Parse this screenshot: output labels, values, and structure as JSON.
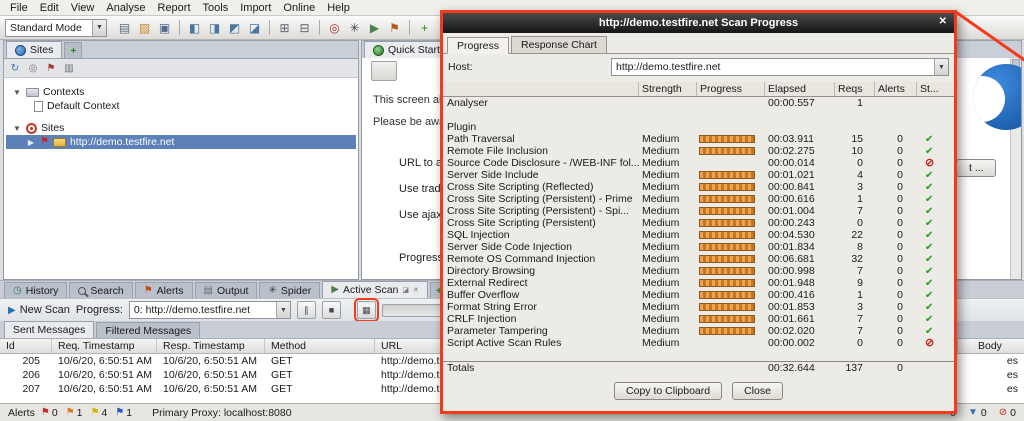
{
  "annotation_color": "#f43a1a",
  "menu": {
    "items": [
      "File",
      "Edit",
      "View",
      "Analyse",
      "Report",
      "Tools",
      "Import",
      "Online",
      "Help"
    ]
  },
  "toolbar": {
    "mode": "Standard Mode",
    "icons": [
      {
        "name": "new-session-icon",
        "glyph": "▤",
        "color": "#5b6c7c"
      },
      {
        "name": "open-session-icon",
        "glyph": "▨",
        "color": "#c08f2c"
      },
      {
        "name": "persist-session-icon",
        "glyph": "▣",
        "color": "#50688a"
      },
      {
        "name": "separator"
      },
      {
        "name": "maximize-pane-icon",
        "glyph": "◧",
        "color": "#49759f"
      },
      {
        "name": "layout-left-icon",
        "glyph": "◨",
        "color": "#49759f"
      },
      {
        "name": "layout-top-icon",
        "glyph": "◩",
        "color": "#49759f"
      },
      {
        "name": "layout-full-icon",
        "glyph": "◪",
        "color": "#49759f"
      },
      {
        "name": "separator"
      },
      {
        "name": "expand-tree-icon",
        "glyph": "⊞",
        "color": "#5a5f66"
      },
      {
        "name": "collapse-tree-icon",
        "glyph": "⊟",
        "color": "#5a5f66"
      },
      {
        "name": "separator"
      },
      {
        "name": "target-scope-icon",
        "glyph": "◎",
        "color": "#b03030"
      },
      {
        "name": "spider-icon",
        "glyph": "✳",
        "color": "#3d4247"
      },
      {
        "name": "active-scan-icon",
        "glyph": "▶",
        "color": "#4c7f4c"
      },
      {
        "name": "alerts-flag-icon",
        "glyph": "⚑",
        "color": "#b35a1f"
      },
      {
        "name": "separator"
      },
      {
        "name": "add-icon",
        "glyph": "+",
        "color": "#2e8b2e"
      },
      {
        "name": "stop-all-icon",
        "glyph": "✕",
        "color": "#c03030"
      },
      {
        "name": "refresh-icon",
        "glyph": "↻",
        "color": "#3a6fae"
      }
    ]
  },
  "left_panel": {
    "tab": "Sites",
    "add_tab": "+",
    "toolbar_icons": [
      {
        "name": "refresh-sites-icon",
        "glyph": "↻",
        "color": "#3a6fae"
      },
      {
        "name": "scope-filter-icon",
        "glyph": "◎",
        "color": "#777777"
      },
      {
        "name": "flag-filter-icon",
        "glyph": "⚑",
        "color": "#a33a2a"
      },
      {
        "name": "list-view-icon",
        "glyph": "▥",
        "color": "#666e78"
      }
    ],
    "tree": {
      "contexts": "Contexts",
      "default_context": "Default Context",
      "sites": "Sites",
      "site": "http://demo.testfire.net"
    }
  },
  "quick_start": {
    "tab": "Quick Start",
    "lines": [
      "This screen allo",
      "Please be awa"
    ],
    "field_labels": [
      "URL to at",
      "Use tradi",
      "Use ajax",
      "Progress"
    ],
    "button_fragment": "t ..."
  },
  "bottom_tabs": {
    "tabs": [
      "History",
      "Search",
      "Alerts",
      "Output",
      "Spider",
      "Active Scan"
    ],
    "add_tab": "+"
  },
  "scan_toolbar": {
    "new_scan": "New Scan",
    "progress_label": "Progress:",
    "progress_value": "0: http://demo.testfire.net"
  },
  "messages": {
    "tabs": [
      "Sent Messages",
      "Filtered Messages"
    ],
    "columns": [
      "Id",
      "Req. Timestamp",
      "Resp. Timestamp",
      "Method",
      "URL",
      "Body"
    ],
    "rows": [
      {
        "id": "205",
        "req": "10/6/20, 6:50:51 AM",
        "resp": "10/6/20, 6:50:51 AM",
        "method": "GET",
        "url": "http://demo.t",
        "body": "es"
      },
      {
        "id": "206",
        "req": "10/6/20, 6:50:51 AM",
        "resp": "10/6/20, 6:50:51 AM",
        "method": "GET",
        "url": "http://demo.t",
        "body": "es"
      },
      {
        "id": "207",
        "req": "10/6/20, 6:50:51 AM",
        "resp": "10/6/20, 6:50:51 AM",
        "method": "GET",
        "url": "http://demo.t",
        "body": "es"
      }
    ]
  },
  "status_bar": {
    "alerts_label": "Alerts",
    "flags": [
      {
        "name": "red-flag-count",
        "color": "#cc2a2a",
        "count": "0"
      },
      {
        "name": "orange-flag-count",
        "color": "#e07b1f",
        "count": "1"
      },
      {
        "name": "yellow-flag-count",
        "color": "#d0b40a",
        "count": "4"
      },
      {
        "name": "blue-flag-count",
        "color": "#2457c5",
        "count": "1"
      }
    ],
    "proxy": "Primary Proxy: localhost:8080",
    "right_counters": [
      {
        "name": "scan-progress-count",
        "glyph": "◐",
        "color": "#667",
        "count": "0"
      },
      {
        "name": "download-count",
        "glyph": "▼",
        "color": "#3a6fae",
        "count": "0"
      },
      {
        "name": "blocked-count",
        "glyph": "⊘",
        "color": "#cc2418",
        "count": "0"
      }
    ]
  },
  "dialog": {
    "title": "http://demo.testfire.net Scan Progress",
    "tabs": [
      "Progress",
      "Response Chart"
    ],
    "host_label": "Host:",
    "host_value": "http://demo.testfire.net",
    "columns": [
      "",
      "Strength",
      "Progress",
      "Elapsed",
      "Reqs",
      "Alerts",
      "St..."
    ],
    "rows": [
      {
        "name": "Analyser",
        "strength": "",
        "bar": false,
        "elapsed": "00:00.557",
        "reqs": "1",
        "alerts": "",
        "status": ""
      },
      {
        "name": "",
        "strength": "",
        "bar": false,
        "elapsed": "",
        "reqs": "",
        "alerts": "",
        "status": ""
      },
      {
        "name": "Plugin",
        "strength": "",
        "bar": false,
        "elapsed": "",
        "reqs": "",
        "alerts": "",
        "status": ""
      },
      {
        "name": "Path Traversal",
        "strength": "Medium",
        "bar": true,
        "elapsed": "00:03.911",
        "reqs": "15",
        "alerts": "0",
        "status": "ok"
      },
      {
        "name": "Remote File Inclusion",
        "strength": "Medium",
        "bar": true,
        "elapsed": "00:02.275",
        "reqs": "10",
        "alerts": "0",
        "status": "ok"
      },
      {
        "name": "Source Code Disclosure - /WEB-INF fol...",
        "strength": "Medium",
        "bar": false,
        "elapsed": "00:00.014",
        "reqs": "0",
        "alerts": "0",
        "status": "skip"
      },
      {
        "name": "Server Side Include",
        "strength": "Medium",
        "bar": true,
        "elapsed": "00:01.021",
        "reqs": "4",
        "alerts": "0",
        "status": "ok"
      },
      {
        "name": "Cross Site Scripting (Reflected)",
        "strength": "Medium",
        "bar": true,
        "elapsed": "00:00.841",
        "reqs": "3",
        "alerts": "0",
        "status": "ok"
      },
      {
        "name": "Cross Site Scripting (Persistent) - Prime",
        "strength": "Medium",
        "bar": true,
        "elapsed": "00:00.616",
        "reqs": "1",
        "alerts": "0",
        "status": "ok"
      },
      {
        "name": "Cross Site Scripting (Persistent) - Spi...",
        "strength": "Medium",
        "bar": true,
        "elapsed": "00:01.004",
        "reqs": "7",
        "alerts": "0",
        "status": "ok"
      },
      {
        "name": "Cross Site Scripting (Persistent)",
        "strength": "Medium",
        "bar": true,
        "elapsed": "00:00.243",
        "reqs": "0",
        "alerts": "0",
        "status": "ok"
      },
      {
        "name": "SQL Injection",
        "strength": "Medium",
        "bar": true,
        "elapsed": "00:04.530",
        "reqs": "22",
        "alerts": "0",
        "status": "ok"
      },
      {
        "name": "Server Side Code Injection",
        "strength": "Medium",
        "bar": true,
        "elapsed": "00:01.834",
        "reqs": "8",
        "alerts": "0",
        "status": "ok"
      },
      {
        "name": "Remote OS Command Injection",
        "strength": "Medium",
        "bar": true,
        "elapsed": "00:06.681",
        "reqs": "32",
        "alerts": "0",
        "status": "ok"
      },
      {
        "name": "Directory Browsing",
        "strength": "Medium",
        "bar": true,
        "elapsed": "00:00.998",
        "reqs": "7",
        "alerts": "0",
        "status": "ok"
      },
      {
        "name": "External Redirect",
        "strength": "Medium",
        "bar": true,
        "elapsed": "00:01.948",
        "reqs": "9",
        "alerts": "0",
        "status": "ok"
      },
      {
        "name": "Buffer Overflow",
        "strength": "Medium",
        "bar": true,
        "elapsed": "00:00.416",
        "reqs": "1",
        "alerts": "0",
        "status": "ok"
      },
      {
        "name": "Format String Error",
        "strength": "Medium",
        "bar": true,
        "elapsed": "00:01.853",
        "reqs": "3",
        "alerts": "0",
        "status": "ok"
      },
      {
        "name": "CRLF Injection",
        "strength": "Medium",
        "bar": true,
        "elapsed": "00:01.661",
        "reqs": "7",
        "alerts": "0",
        "status": "ok"
      },
      {
        "name": "Parameter Tampering",
        "strength": "Medium",
        "bar": true,
        "elapsed": "00:02.020",
        "reqs": "7",
        "alerts": "0",
        "status": "ok"
      },
      {
        "name": "Script Active Scan Rules",
        "strength": "Medium",
        "bar": false,
        "elapsed": "00:00.002",
        "reqs": "0",
        "alerts": "0",
        "status": "skip"
      },
      {
        "name": "",
        "strength": "",
        "bar": false,
        "elapsed": "",
        "reqs": "",
        "alerts": "",
        "status": ""
      },
      {
        "name": "Totals",
        "strength": "",
        "bar": false,
        "elapsed": "00:32.644",
        "reqs": "137",
        "alerts": "0",
        "status": "",
        "total": true
      }
    ],
    "buttons": [
      "Copy to Clipboard",
      "Close"
    ]
  }
}
